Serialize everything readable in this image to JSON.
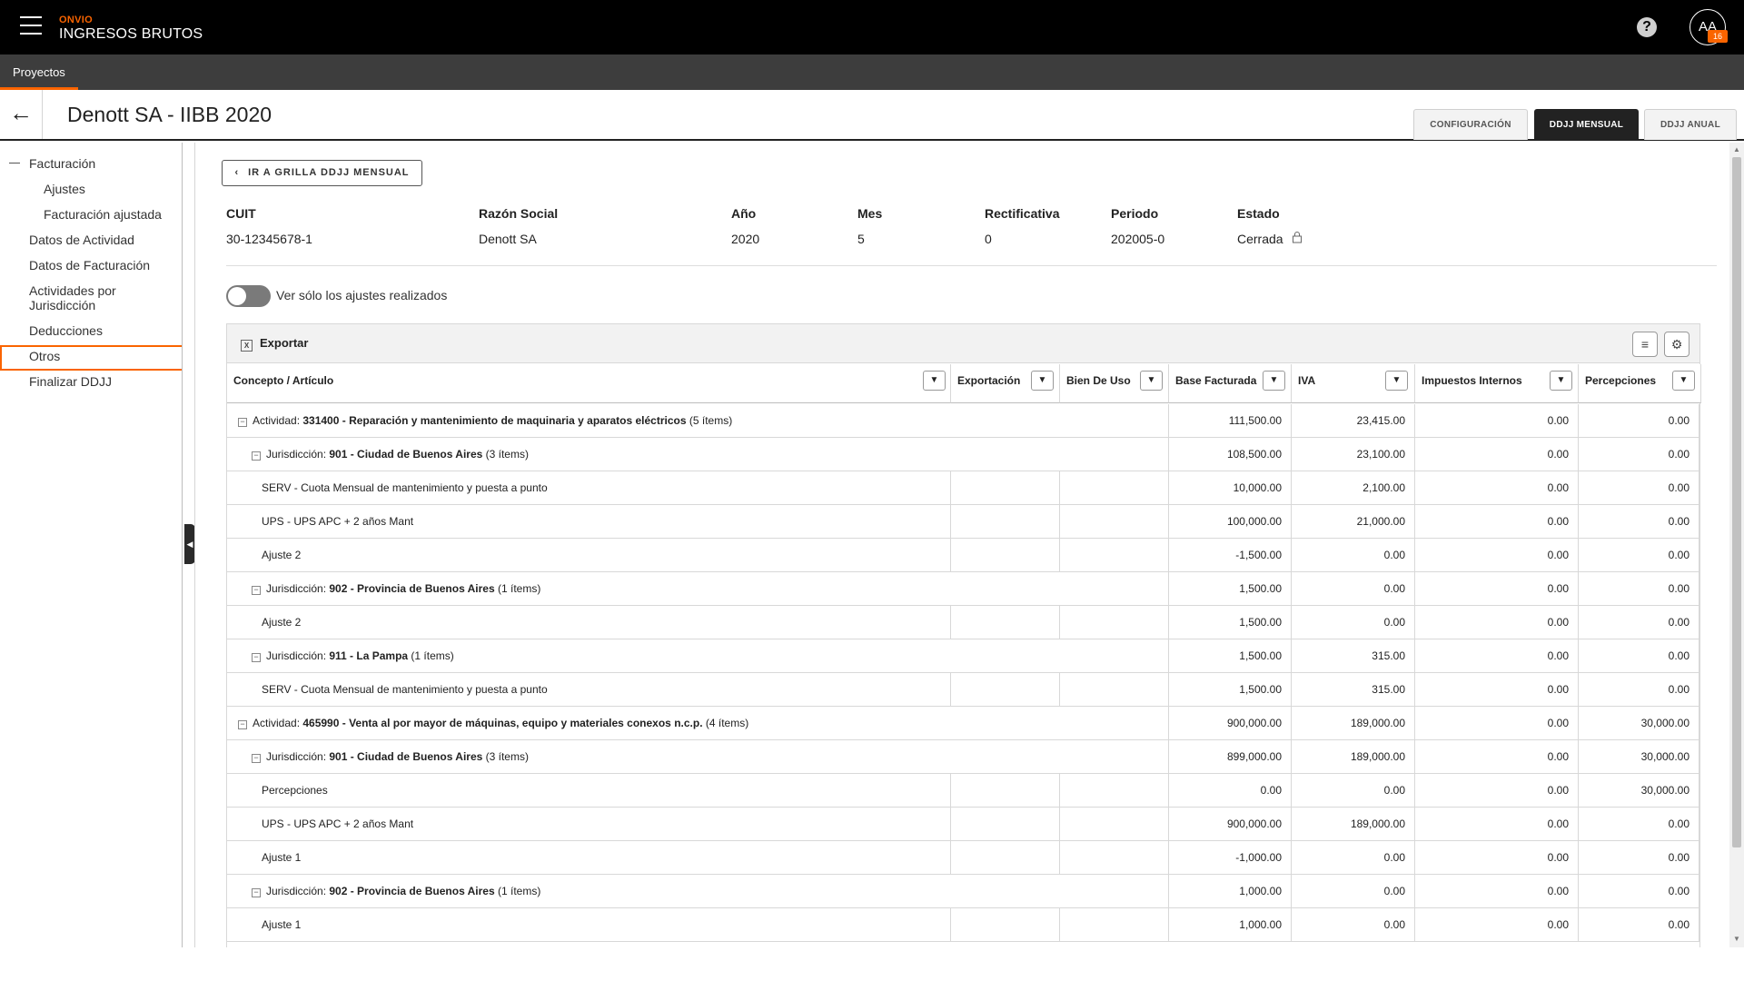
{
  "app": {
    "brand_small": "ONVIO",
    "brand_main": "INGRESOS BRUTOS",
    "avatar": "AA",
    "avatar_badge": "16",
    "help": "?",
    "accent": "#fa6400"
  },
  "nav": {
    "tab": "Proyectos"
  },
  "header": {
    "title": "Denott SA - IIBB 2020",
    "tabs": [
      "CONFIGURACIÓN",
      "DDJJ MENSUAL",
      "DDJJ ANUAL"
    ],
    "active_tab": "DDJJ MENSUAL"
  },
  "sidebar": {
    "group": "Facturación",
    "items": [
      "Ajustes",
      "Facturación ajustada",
      "Datos de Actividad",
      "Datos de Facturación",
      "Actividades por Jurisdicción",
      "Deducciones",
      "Otros",
      "Finalizar DDJJ"
    ]
  },
  "back_grid": "IR A GRILLA DDJJ MENSUAL",
  "info": {
    "labels": [
      "CUIT",
      "Razón Social",
      "Año",
      "Mes",
      "Rectificativa",
      "Periodo",
      "Estado"
    ],
    "values": [
      "30-12345678-1",
      "Denott SA",
      "2020",
      "5",
      "0",
      "202005-0",
      "Cerrada"
    ]
  },
  "toggle": {
    "label": "Ver sólo los ajustes realizados",
    "on": false
  },
  "grid": {
    "export": "Exportar",
    "columns": [
      "Concepto / Artículo",
      "Exportación",
      "Bien De Uso",
      "Base Facturada",
      "IVA",
      "Impuestos Internos",
      "Percepciones"
    ],
    "rows": [
      {
        "level": 0,
        "prefix": "Actividad: ",
        "code": "331400 - Reparación y mantenimiento de maquinaria y aparatos eléctricos",
        "suffix": " (5 ítems)",
        "base": "111,500.00",
        "iva": "23,415.00",
        "ii": "0.00",
        "perc": "0.00"
      },
      {
        "level": 1,
        "prefix": "Jurisdicción: ",
        "code": "901 - Ciudad de Buenos Aires",
        "suffix": " (3 ítems)",
        "base": "108,500.00",
        "iva": "23,100.00",
        "ii": "0.00",
        "perc": "0.00"
      },
      {
        "level": 2,
        "text": "SERV - Cuota Mensual de mantenimiento y puesta a punto",
        "base": "10,000.00",
        "iva": "2,100.00",
        "ii": "0.00",
        "perc": "0.00"
      },
      {
        "level": 2,
        "text": "UPS - UPS APC + 2 años Mant",
        "base": "100,000.00",
        "iva": "21,000.00",
        "ii": "0.00",
        "perc": "0.00"
      },
      {
        "level": 2,
        "text": "Ajuste 2",
        "base": "-1,500.00",
        "iva": "0.00",
        "ii": "0.00",
        "perc": "0.00"
      },
      {
        "level": 1,
        "prefix": "Jurisdicción: ",
        "code": "902 - Provincia de Buenos Aires",
        "suffix": " (1 ítems)",
        "base": "1,500.00",
        "iva": "0.00",
        "ii": "0.00",
        "perc": "0.00"
      },
      {
        "level": 2,
        "text": "Ajuste 2",
        "base": "1,500.00",
        "iva": "0.00",
        "ii": "0.00",
        "perc": "0.00"
      },
      {
        "level": 1,
        "prefix": "Jurisdicción: ",
        "code": "911 - La Pampa",
        "suffix": " (1 ítems)",
        "base": "1,500.00",
        "iva": "315.00",
        "ii": "0.00",
        "perc": "0.00"
      },
      {
        "level": 2,
        "text": "SERV - Cuota Mensual de mantenimiento y puesta a punto",
        "base": "1,500.00",
        "iva": "315.00",
        "ii": "0.00",
        "perc": "0.00"
      },
      {
        "level": 0,
        "prefix": "Actividad: ",
        "code": "465990 - Venta al por mayor de máquinas, equipo y materiales conexos n.c.p.",
        "suffix": " (4 ítems)",
        "base": "900,000.00",
        "iva": "189,000.00",
        "ii": "0.00",
        "perc": "30,000.00"
      },
      {
        "level": 1,
        "prefix": "Jurisdicción: ",
        "code": "901 - Ciudad de Buenos Aires",
        "suffix": " (3 ítems)",
        "base": "899,000.00",
        "iva": "189,000.00",
        "ii": "0.00",
        "perc": "30,000.00"
      },
      {
        "level": 2,
        "text": "Percepciones",
        "base": "0.00",
        "iva": "0.00",
        "ii": "0.00",
        "perc": "30,000.00"
      },
      {
        "level": 2,
        "text": "UPS - UPS APC + 2 años Mant",
        "base": "900,000.00",
        "iva": "189,000.00",
        "ii": "0.00",
        "perc": "0.00"
      },
      {
        "level": 2,
        "text": "Ajuste 1",
        "base": "-1,000.00",
        "iva": "0.00",
        "ii": "0.00",
        "perc": "0.00"
      },
      {
        "level": 1,
        "prefix": "Jurisdicción: ",
        "code": "902 - Provincia de Buenos Aires",
        "suffix": " (1 ítems)",
        "base": "1,000.00",
        "iva": "0.00",
        "ii": "0.00",
        "perc": "0.00"
      },
      {
        "level": 2,
        "text": "Ajuste 1",
        "base": "1,000.00",
        "iva": "0.00",
        "ii": "0.00",
        "perc": "0.00"
      }
    ]
  }
}
